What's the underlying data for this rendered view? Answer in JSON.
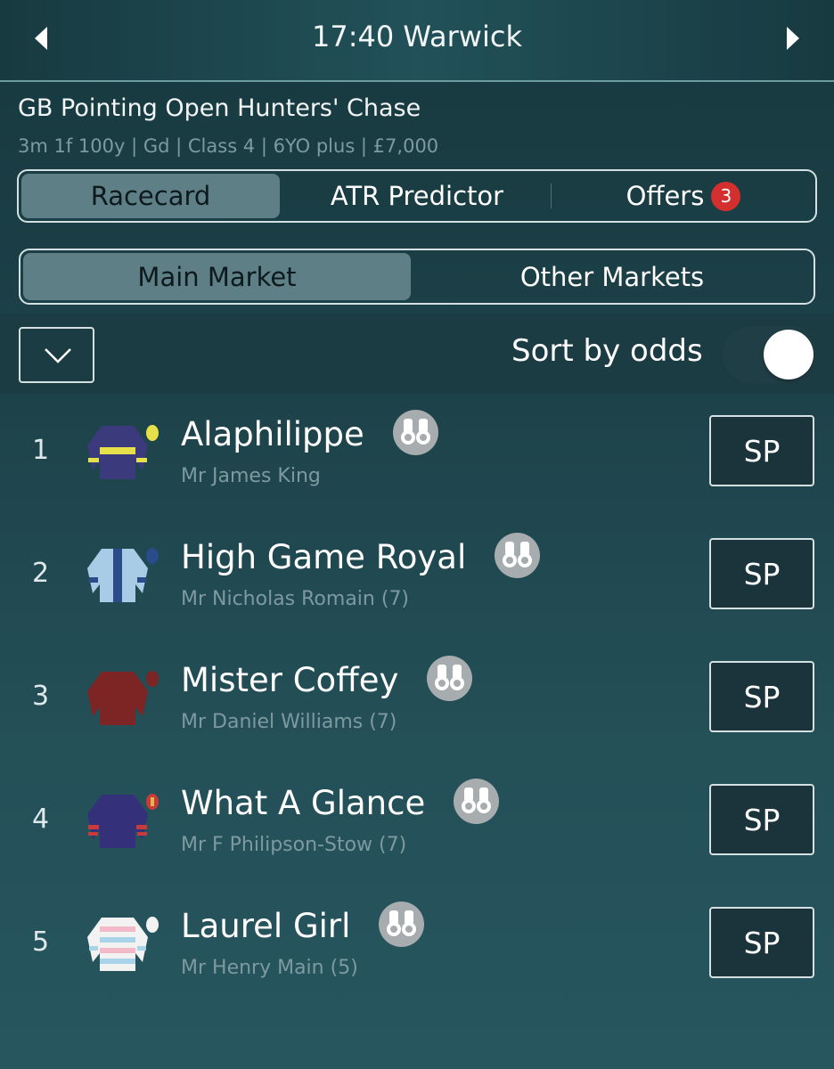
{
  "header": {
    "title": "17:40 Warwick"
  },
  "race": {
    "name": "GB Pointing Open Hunters' Chase",
    "details": "3m 1f 100y | Gd | Class 4 | 6YO plus | £7,000"
  },
  "tabs": [
    {
      "label": "Racecard",
      "active": true
    },
    {
      "label": "ATR Predictor",
      "active": false
    },
    {
      "label": "Offers",
      "active": false,
      "badge": "3"
    }
  ],
  "markets": [
    {
      "label": "Main Market",
      "active": true
    },
    {
      "label": "Other Markets",
      "active": false
    }
  ],
  "sort": {
    "label": "Sort by odds",
    "on": true
  },
  "runners": [
    {
      "number": "1",
      "name": "Alaphilippe",
      "jockey": "Mr James King",
      "odds": "SP",
      "silks": "navy-yellow-hoop"
    },
    {
      "number": "2",
      "name": "High Game Royal",
      "jockey": "Mr Nicholas Romain (7)",
      "odds": "SP",
      "silks": "lightblue-navy-stripe"
    },
    {
      "number": "3",
      "name": "Mister Coffey",
      "jockey": "Mr Daniel Williams (7)",
      "odds": "SP",
      "silks": "maroon"
    },
    {
      "number": "4",
      "name": "What A Glance",
      "jockey": "Mr F Philipson-Stow (7)",
      "odds": "SP",
      "silks": "navy-red-armbands"
    },
    {
      "number": "5",
      "name": "Laurel Girl",
      "jockey": "Mr Henry Main (5)",
      "odds": "SP",
      "silks": "pink-lightblue-hoops"
    }
  ],
  "colors": {
    "accent": "#5f7f86",
    "badge": "#d32f2f",
    "background": "#1d4149"
  }
}
